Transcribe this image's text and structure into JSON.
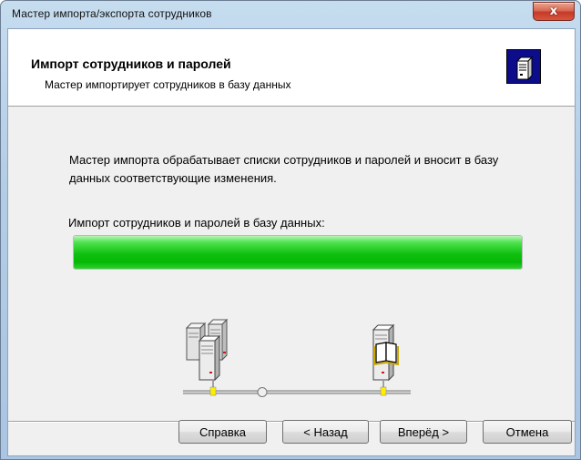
{
  "window": {
    "title": "Мастер импорта/экспорта сотрудников",
    "close_label": "x"
  },
  "header": {
    "title": "Импорт сотрудников и паролей",
    "subtitle": "Мастер импортирует сотрудников в базу данных",
    "icon": "server-icon"
  },
  "body": {
    "description": "Мастер импорта обрабатывает списки сотрудников и паролей и вносит в базу данных соответствующие изменения.",
    "progress_label": "Импорт сотрудников и паролей в базу данных:",
    "progress_fraction": 1.0,
    "progress_color": "#10c010"
  },
  "network": {
    "left_icon": "server-cluster-icon",
    "right_icon": "database-server-icon"
  },
  "buttons": {
    "help": "Справка",
    "back": "< Назад",
    "next": "Вперёд >",
    "cancel": "Отмена"
  }
}
